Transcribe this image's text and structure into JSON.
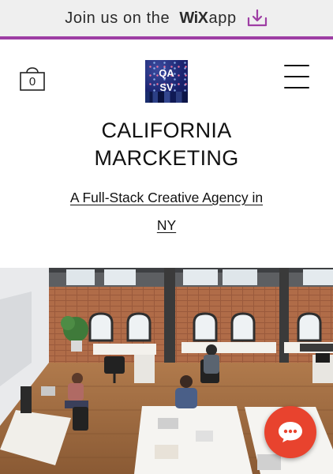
{
  "banner": {
    "text": "Join us on the",
    "brand": "WiX",
    "app": "app",
    "accent_color": "#9e3ea4",
    "icon": "download-icon"
  },
  "header": {
    "cart": {
      "count": "0",
      "icon": "shopping-bag-icon"
    },
    "logo": {
      "text_line1": "QA",
      "text_line2": "SV"
    },
    "menu_icon": "hamburger-menu-icon"
  },
  "hero": {
    "title_line1": "CALIFORNIA",
    "title_line2": "MARCKETING",
    "tagline_line1": "A Full-Stack Creative Agency in",
    "tagline_line2": "NY"
  },
  "chat": {
    "icon": "chat-bubble-icon",
    "color": "#e8432e"
  }
}
